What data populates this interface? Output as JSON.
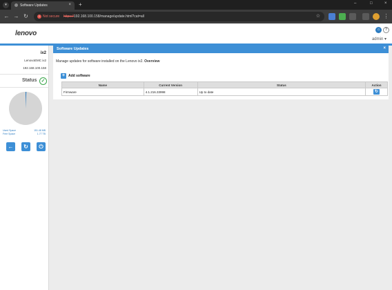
{
  "browser": {
    "tab_title": "Software Updates",
    "tab_close": "×",
    "new_tab": "+",
    "not_secure": "Not secure",
    "url_scheme": "https://",
    "url_rest": "192.168.100.158/manage/update.html?cat=all",
    "colors": {
      "not_secure": "#ec6b63"
    }
  },
  "header": {
    "logo": "lenovo",
    "user": "admin",
    "icons": [
      "home-icon",
      "help-icon",
      "chevron-down-icon"
    ]
  },
  "device": {
    "name": "ix2",
    "model": "LenovoEMC ix2",
    "ip": "192.168.100.158",
    "status_label": "Status",
    "used_label": "Used Space",
    "used_value": "151.48 MB",
    "free_label": "Free Space",
    "free_value": "1.77 TB",
    "used_fraction": 0.0008,
    "colors": {
      "used": "#2c7cc1",
      "free": "#d5d5d5",
      "ok": "#3aa64a"
    }
  },
  "dialog": {
    "title": "Software Updates",
    "close": "×",
    "description": "Manage updates for software installed on the Lenovo ix2.",
    "description_link": "Overview",
    "add_label": "Add software",
    "columns": [
      "Name",
      "Current Version",
      "Status",
      "Action"
    ],
    "rows": [
      {
        "name": "Firmware",
        "version": "4.1.216.33998",
        "status": "Up to date"
      }
    ]
  },
  "theme": {
    "accent": "#3d8fd6"
  }
}
